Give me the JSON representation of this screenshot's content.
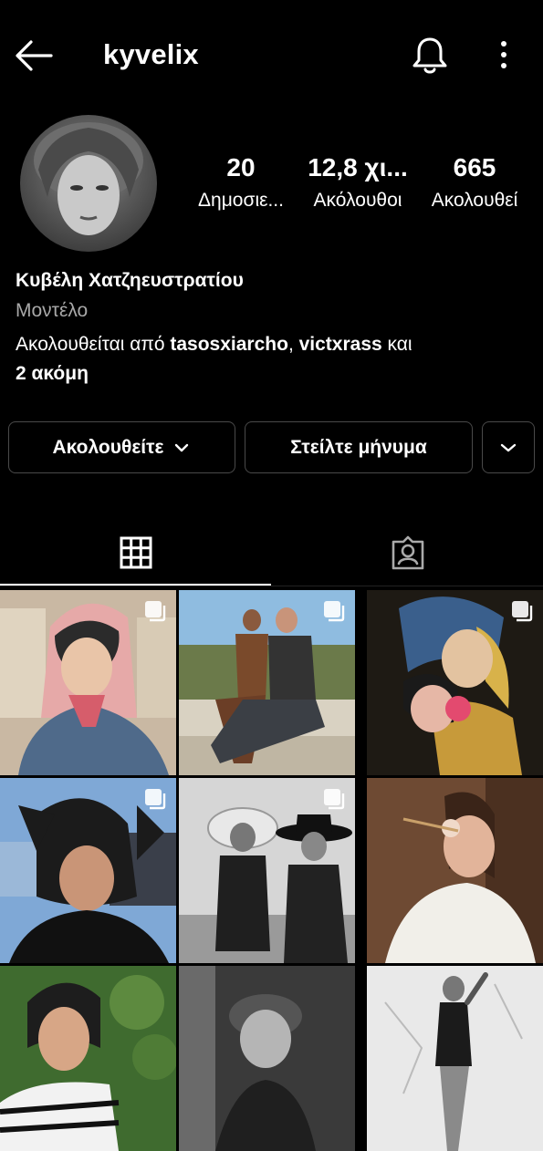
{
  "header": {
    "username": "kyvelix",
    "icons": [
      "back-arrow-icon",
      "bell-icon",
      "more-vertical-icon"
    ]
  },
  "stats": {
    "posts": {
      "value": "20",
      "label": "Δημοσιε..."
    },
    "followers": {
      "value": "12,8 χι...",
      "label": "Ακόλουθοι"
    },
    "following": {
      "value": "665",
      "label": "Ακολουθεί"
    }
  },
  "bio": {
    "name": "Κυβέλη Χατζηευστρατίου",
    "category": "Μοντέλο",
    "followed_by_prefix": "Ακολουθείται από ",
    "follower_1": "tasosxiarcho",
    "separator": ", ",
    "follower_2": "victxrass",
    "conjunction": " και",
    "more": "2 ακόμη"
  },
  "actions": {
    "follow_label": "Ακολουθείτε",
    "message_label": "Στείλτε μήνυμα"
  },
  "tabs": [
    {
      "name": "grid",
      "icon": "grid-icon",
      "active": true
    },
    {
      "name": "tagged",
      "icon": "tagged-person-icon",
      "active": false
    }
  ],
  "posts": [
    {
      "multi": true,
      "tone": "color"
    },
    {
      "multi": true,
      "tone": "color"
    },
    {
      "multi": true,
      "tone": "color"
    },
    {
      "multi": true,
      "tone": "color"
    },
    {
      "multi": true,
      "tone": "bw"
    },
    {
      "multi": false,
      "tone": "color"
    },
    {
      "multi": false,
      "tone": "color"
    },
    {
      "multi": false,
      "tone": "bw"
    },
    {
      "multi": false,
      "tone": "bw"
    }
  ],
  "colors": {
    "background": "#000000",
    "text": "#ffffff",
    "secondary_text": "#a8a8a8",
    "button_border": "#4a4a4a"
  }
}
